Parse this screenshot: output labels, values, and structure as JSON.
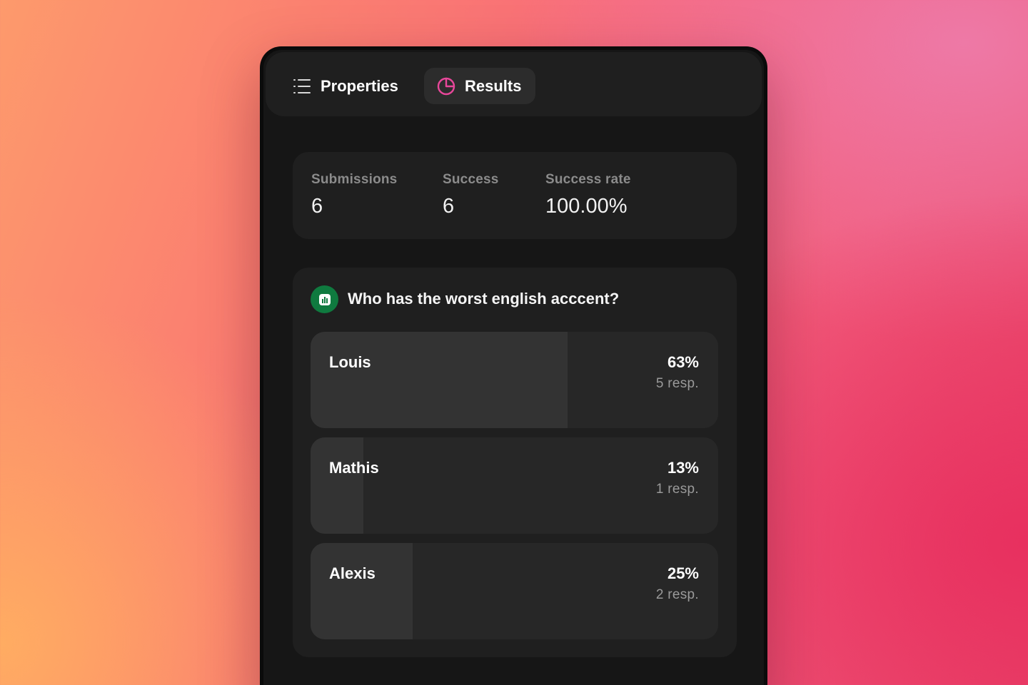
{
  "tabs": [
    {
      "label": "Properties",
      "icon": "list-icon",
      "active": false
    },
    {
      "label": "Results",
      "icon": "pie-chart-icon",
      "active": true
    }
  ],
  "stats": [
    {
      "label": "Submissions",
      "value": "6"
    },
    {
      "label": "Success",
      "value": "6"
    },
    {
      "label": "Success rate",
      "value": "100.00%"
    }
  ],
  "question": {
    "icon": "bar-chart-icon",
    "title": "Who has the worst english acccent?",
    "options": [
      {
        "label": "Louis",
        "percent_text": "63%",
        "responses_text": "5 resp.",
        "fill_fraction": 0.63
      },
      {
        "label": "Mathis",
        "percent_text": "13%",
        "responses_text": "1 resp.",
        "fill_fraction": 0.13
      },
      {
        "label": "Alexis",
        "percent_text": "25%",
        "responses_text": "2 resp.",
        "fill_fraction": 0.25
      }
    ]
  },
  "colors": {
    "results_icon_accent": "#e8479a",
    "poll_icon_bg": "#0f7a3f",
    "panel_bg": "#161616",
    "card_bg": "#1f1f1f"
  }
}
